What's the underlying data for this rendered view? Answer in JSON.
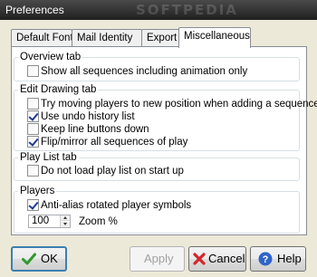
{
  "window": {
    "title": "Preferences",
    "watermark": "SOFTPEDIA"
  },
  "tabs": [
    {
      "label": "Default Font"
    },
    {
      "label": "Mail Identity"
    },
    {
      "label": "Export"
    },
    {
      "label": "Miscellaneous",
      "active": true
    }
  ],
  "groups": {
    "overview": {
      "title": "Overview tab",
      "items": [
        {
          "label": "Show all sequences including animation only",
          "checked": false
        }
      ]
    },
    "edit_drawing": {
      "title": "Edit Drawing tab",
      "items": [
        {
          "label": "Try moving players to new position when adding a sequence",
          "checked": false
        },
        {
          "label": "Use undo history list",
          "checked": true
        },
        {
          "label": "Keep line buttons down",
          "checked": false
        },
        {
          "label": "Flip/mirror all sequences of play",
          "checked": true
        }
      ]
    },
    "play_list": {
      "title": "Play List tab",
      "items": [
        {
          "label": "Do not load play list on start up",
          "checked": false
        }
      ]
    },
    "players": {
      "title": "Players",
      "items": [
        {
          "label": "Anti-alias rotated player symbols",
          "checked": true
        }
      ],
      "zoom": {
        "value": "100",
        "label": "Zoom %"
      }
    }
  },
  "buttons": {
    "ok": "OK",
    "apply": "Apply",
    "cancel": "Cancel",
    "help": "Help"
  },
  "colors": {
    "ok_check": "#2e9a2e",
    "cancel_x": "#d3262b",
    "help_icon": "#2f64c8"
  },
  "icons": {
    "ok": "check-icon",
    "cancel": "x-icon",
    "help": "question-icon"
  }
}
